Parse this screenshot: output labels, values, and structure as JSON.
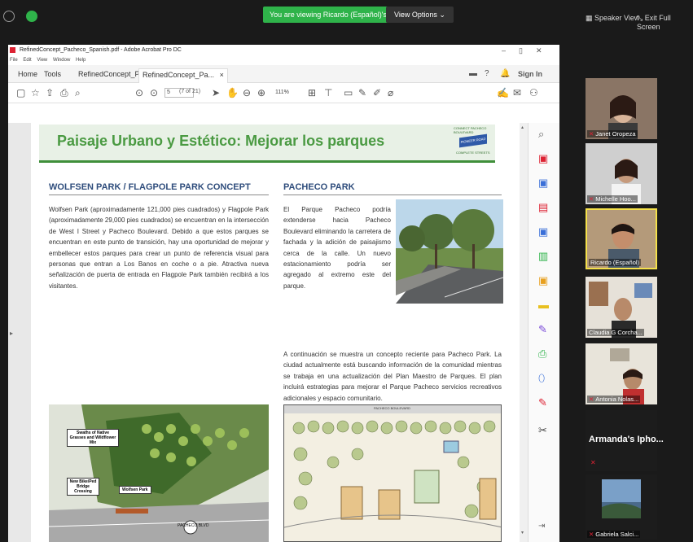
{
  "zoom": {
    "viewing_banner": "You are viewing Ricardo (Español)'s screen",
    "view_options": "View Options ⌄",
    "speaker_view": "Speaker View",
    "exit_full_screen": "Exit Full Screen"
  },
  "acrobat": {
    "window_title": "RefinedConcept_Pacheco_Spanish.pdf - Adobe Acrobat Pro DC",
    "menu": [
      "File",
      "Edit",
      "View",
      "Window",
      "Help"
    ],
    "tabs": {
      "home": "Home",
      "tools": "Tools",
      "doc1": "RefinedConcept_Pl...",
      "doc2": "RefinedConcept_Pa...",
      "close": "×"
    },
    "sign_in": "Sign In",
    "page_number": "5",
    "page_count": "(7 of 21)",
    "zoom_level": "111%"
  },
  "pdf": {
    "banner_title": "Paisaje Urbano y Estético: Mejorar los parques",
    "logo_top": "CONNECT PACHECO BOULEVARD",
    "logo_sign": "PIONEER ROAD",
    "logo_bottom": "COMPLETE STREETS",
    "left_heading": "WOLFSEN PARK / FLAGPOLE PARK CONCEPT",
    "right_heading": "PACHECO PARK",
    "left_paragraph": "Wolfsen Park (aproximadamente 121,000 pies cuadrados) y Flagpole Park (aproximadamente 29,000 pies cuadrados) se encuentran en la intersección de West I Street y Pacheco Boulevard. Debido a que estos parques se encuentran en este punto de transición, hay una oportunidad de mejorar y embellecer estos parques para crear un punto de referencia visual para personas que entran a Los Banos en coche o a pie. Atractiva nueva señalización de puerta de entrada en Flagpole Park también recibirá a los visitantes.",
    "right_paragraph": "El Parque Pacheco podría extenderse hacia Pacheco Boulevard eliminando la carretera de fachada y la adición de paisajismo cerca de la calle. Un nuevo estacionamiento podría ser agregado al extremo este del parque.",
    "bottom_paragraph": "A continuación se muestra un concepto reciente para Pacheco Park. La ciudad actualmente está buscando información de la comunidad mientras se trabaja en una actualización del Plan Maestro de Parques. El plan incluirá estrategias para mejorar el Parque Pacheco servicios recreativos adicionales y espacio comunitario.",
    "map_left_label1": "Swaths of Native Grasses and Wildflower Mix",
    "map_left_label2": "New Bike/Ped Bridge Crossing",
    "map_left_label3": "Wolfsen Park",
    "map_left_street": "PACHECO BLVD",
    "map_right_street": "PACHECO BOULEVARD"
  },
  "participants": [
    {
      "name": "Janet Oropeza"
    },
    {
      "name": "Michelle Hoo..."
    },
    {
      "name": "Ricardo (Español)"
    },
    {
      "name": "Claudia G Corcha..."
    },
    {
      "name": "Antonia Nolas..."
    },
    {
      "name": "Armanda's Ipho..."
    },
    {
      "name": "Gabriela Salci..."
    }
  ],
  "colors": {
    "zoom_green": "#2fb34a",
    "banner_green": "#4a9a42",
    "heading_blue": "#2f4d7c",
    "active_speaker": "#f5e14b"
  }
}
